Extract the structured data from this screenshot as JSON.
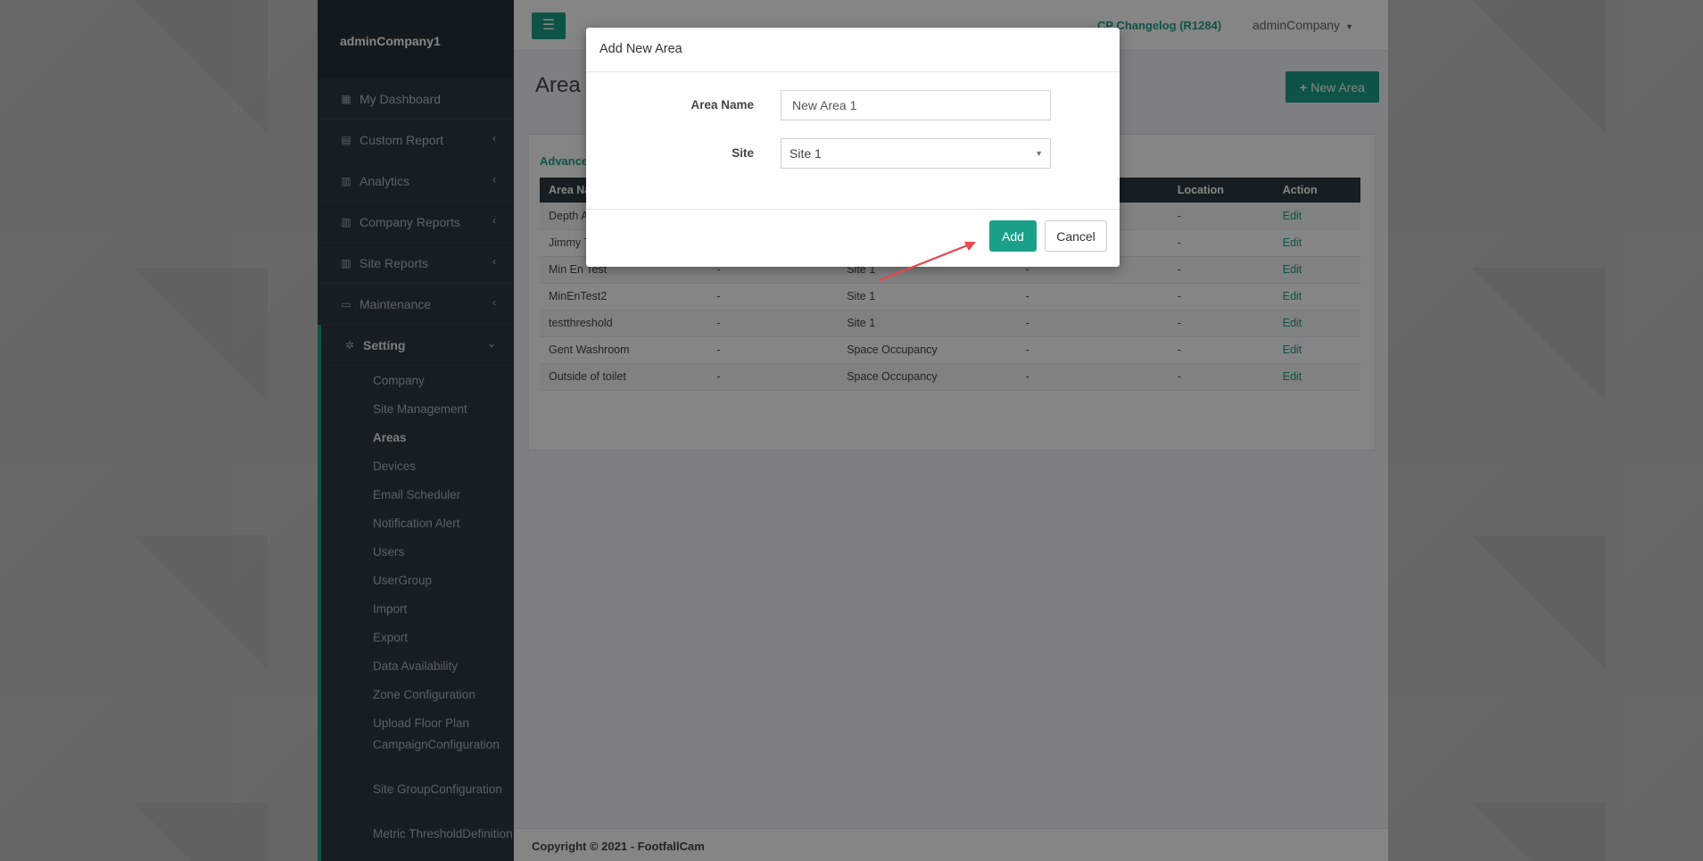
{
  "sidebar": {
    "company": "adminCompany1",
    "items": [
      {
        "label": "My Dashboard",
        "icon": "dashboard-icon",
        "glyph": "▦"
      },
      {
        "label": "Custom Report",
        "icon": "document-icon",
        "glyph": "▤"
      },
      {
        "label": "Analytics",
        "icon": "bar-chart-icon",
        "glyph": "▥"
      },
      {
        "label": "Company Reports",
        "icon": "line-chart-icon",
        "glyph": "▥"
      },
      {
        "label": "Site Reports",
        "icon": "line-chart-icon",
        "glyph": "▥"
      },
      {
        "label": "Maintenance",
        "icon": "monitor-icon",
        "glyph": "▭"
      },
      {
        "label": "Setting",
        "icon": "gears-icon",
        "glyph": "✲"
      }
    ],
    "submenu": [
      "Company",
      "Site Management",
      "Areas",
      "Devices",
      "Email Scheduler",
      "Notification Alert",
      "Users",
      "UserGroup",
      "Import",
      "Export",
      "Data Availability",
      "Zone Configuration",
      "Upload Floor Plan"
    ],
    "submenu_two_line": [
      {
        "line1": "Campaign",
        "line2": "Configuration"
      },
      {
        "line1": "Site Group",
        "line2": "Configuration"
      },
      {
        "line1": "Metric Threshold",
        "line2": "Definition"
      }
    ]
  },
  "topbar": {
    "changelog": "CP Changelog (R1284)",
    "user": "adminCompany"
  },
  "page": {
    "title": "Area",
    "new_area_label": "New Area",
    "advanced": "Advance"
  },
  "table": {
    "headers": [
      "Area Na",
      "",
      "",
      "",
      "Location",
      "Action"
    ],
    "rows": [
      [
        "Depth A",
        "",
        "",
        "",
        "-",
        "Edit"
      ],
      [
        "Jimmy T",
        "",
        "",
        "",
        "-",
        "Edit"
      ],
      [
        "Min En Test",
        "-",
        "Site 1",
        "-",
        "-",
        "Edit"
      ],
      [
        "MinEnTest2",
        "-",
        "Site 1",
        "-",
        "-",
        "Edit"
      ],
      [
        "testthreshold",
        "-",
        "Site 1",
        "-",
        "-",
        "Edit"
      ],
      [
        "Gent Washroom",
        "-",
        "Space Occupancy",
        "-",
        "-",
        "Edit"
      ],
      [
        "Outside of toilet",
        "-",
        "Space Occupancy",
        "-",
        "-",
        "Edit"
      ]
    ]
  },
  "footer": "Copyright © 2021 - FootfallCam",
  "modal": {
    "title": "Add New Area",
    "area_name_label": "Area Name",
    "area_name_value": "New Area 1",
    "site_label": "Site",
    "site_value": "Site 1",
    "add_label": "Add",
    "cancel_label": "Cancel"
  },
  "colors": {
    "accent": "#1aa088",
    "sidebar": "#2b3a45",
    "annotation_arrow": "#e8474c"
  }
}
